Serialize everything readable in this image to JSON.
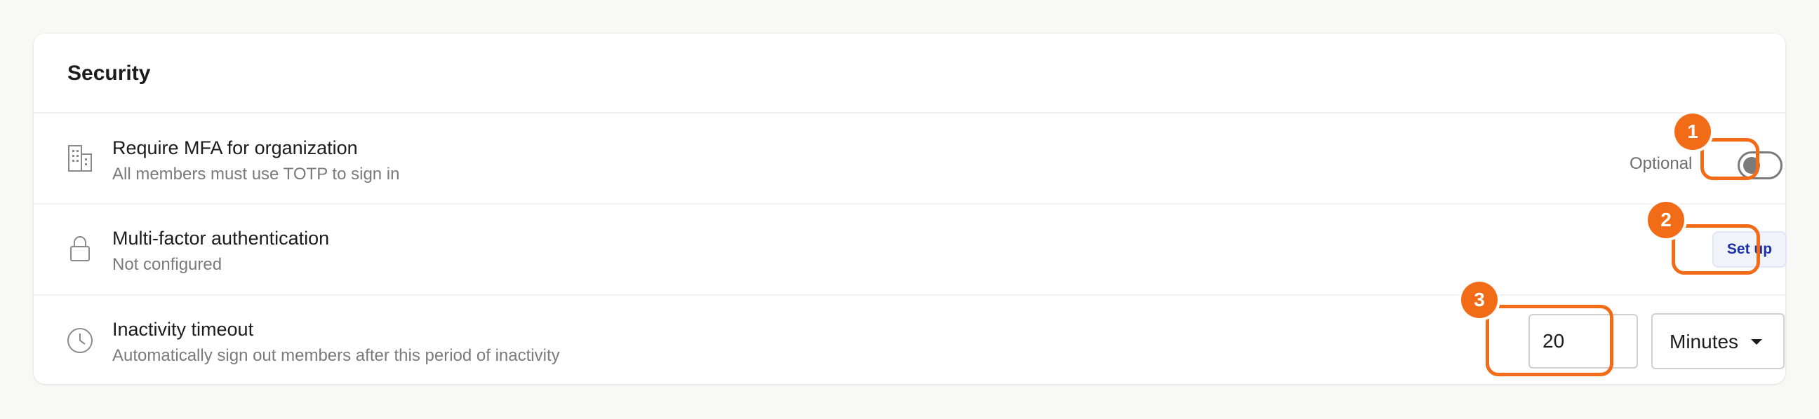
{
  "section": {
    "title": "Security"
  },
  "rows": [
    {
      "icon": "building-icon",
      "title": "Require MFA for organization",
      "subtitle": "All members must use TOTP to sign in",
      "status_label": "Optional",
      "toggle_on": false
    },
    {
      "icon": "lock-icon",
      "title": "Multi-factor authentication",
      "subtitle": "Not configured",
      "button_label": "Set up"
    },
    {
      "icon": "clock-icon",
      "title": "Inactivity timeout",
      "subtitle": "Automatically sign out members after this period of inactivity",
      "timeout_value": "20",
      "unit_selected": "Minutes"
    }
  ],
  "annotations": [
    "1",
    "2",
    "3"
  ],
  "colors": {
    "annotation": "#f26b16",
    "button_text": "#1a2fa8",
    "button_bg": "#f1f3fb"
  }
}
